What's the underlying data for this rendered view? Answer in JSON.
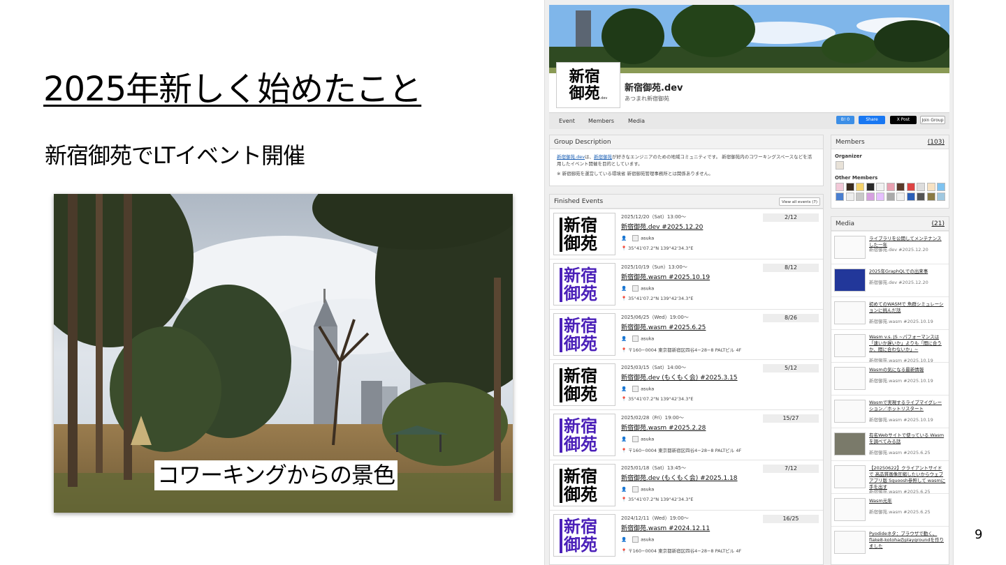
{
  "slide": {
    "title": "2025年新しく始めたこと",
    "subtitle": "新宿御苑でLTイベント開催",
    "photo_caption": "コワーキングからの景色",
    "page_number": "9"
  },
  "group": {
    "logo_text_1": "新宿",
    "logo_text_2": "御苑",
    "logo_suffix": ".dev",
    "name": "新宿御苑.dev",
    "tagline": "あつまれ新宿御苑",
    "tabs": [
      "Event",
      "Members",
      "Media"
    ],
    "share": {
      "hatena": "B! 0",
      "facebook": "Share",
      "x": "X Post",
      "join": "Join Group"
    }
  },
  "description": {
    "header": "Group Description",
    "link1": "新宿御苑.dev",
    "text1": "は、",
    "link2": "新宿御苑",
    "text2": "が好きなエンジニアのための地域コミュニティです。 新宿御苑内のコワーキングスペースなどを活用したイベント開催を目的としています。",
    "note": "※ 新宿御苑を運営している環境省 新宿御苑管理事務所とは関係ありません。"
  },
  "finished": {
    "header": "Finished Events",
    "view_all": "View all events (7)",
    "events": [
      {
        "date": "2025/12/20（Sat）13:00〜",
        "title": "新宿御苑.dev #2025.12.20",
        "host": "asuka",
        "loc": "35°41'07.2\"N 139°42'34.3\"E",
        "count": "2/12",
        "variant": "dev"
      },
      {
        "date": "2025/10/19（Sun）13:00〜",
        "title": "新宿御苑.wasm #2025.10.19",
        "host": "asuka",
        "loc": "35°41'07.2\"N 139°42'34.3\"E",
        "count": "8/12",
        "variant": "wasm"
      },
      {
        "date": "2025/06/25（Wed）19:00〜",
        "title": "新宿御苑.wasm #2025.6.25",
        "host": "asuka",
        "loc": "〒160−0004 東京都新宿区四谷4−28−8 PALTビル 4F",
        "count": "8/26",
        "variant": "wasm"
      },
      {
        "date": "2025/03/15（Sat）14:00〜",
        "title": "新宿御苑.dev (もくもく会) #2025.3.15",
        "host": "asuka",
        "loc": "35°41'07.2\"N 139°42'34.3\"E",
        "count": "5/12",
        "variant": "dev"
      },
      {
        "date": "2025/02/28（Fri）19:00〜",
        "title": "新宿御苑.wasm #2025.2.28",
        "host": "asuka",
        "loc": "〒160−0004 東京都新宿区四谷4−28−8 PALTビル 4F",
        "count": "15/27",
        "variant": "wasm"
      },
      {
        "date": "2025/01/18（Sat）13:45〜",
        "title": "新宿御苑.dev (もくもく会) #2025.1.18",
        "host": "asuka",
        "loc": "35°41'07.2\"N 139°42'34.3\"E",
        "count": "7/12",
        "variant": "dev"
      },
      {
        "date": "2024/12/11（Wed）19:00〜",
        "title": "新宿御苑.wasm #2024.12.11",
        "host": "asuka",
        "loc": "〒160−0004 東京都新宿区四谷4−28−8 PALTビル 4F",
        "count": "16/25",
        "variant": "wasm"
      }
    ]
  },
  "members": {
    "header": "Members",
    "count": "(103)",
    "organizer_label": "Organizer",
    "other_label": "Other Members"
  },
  "media": {
    "header": "Media",
    "count": "(21)",
    "items": [
      {
        "title": "ライブラリを公開してメンテナンスした一年",
        "sub": "新宿御苑.dev #2025.12.20"
      },
      {
        "title": "2025年GraphQLでの出来事",
        "sub": "新宿御苑.dev #2025.12.20"
      },
      {
        "title": "初めてのWASMで 魚群シミュレーションに挑んだ話",
        "sub": "新宿御苑.wasm #2025.10.19"
      },
      {
        "title": "Wasm v.s. JS ~パフォーマンスは「速いか遅いか」よりも「間に合うか、間に合わないか」~",
        "sub": "新宿御苑.wasm #2025.10.19"
      },
      {
        "title": "Wasmの気になる最新情報",
        "sub": "新宿御苑.wasm #2025.10.19"
      },
      {
        "title": "Wasmで実現するライブマイグレーション／ホットリスタート",
        "sub": "新宿御苑.wasm #2025.10.19"
      },
      {
        "title": "有名Webサイトで使っている Wasmを調べてみる話",
        "sub": "新宿御苑.wasm #2025.6.25"
      },
      {
        "title": "【20250622】クライアントサイドで 高品質画像圧縮したいからウェブアプリ版 Squoosh参照して wasmに手を出す",
        "sub": "新宿御苑.wasm #2025.6.25"
      },
      {
        "title": "Wasm元年",
        "sub": "新宿御苑.wasm #2025.6.25"
      },
      {
        "title": "Pyodideネタ：ブラウザで動く、flake8-kotohaのplaygroundを作りました",
        "sub": ""
      }
    ]
  },
  "colors": {
    "wasm_purple": "#4a1fb8",
    "link_blue": "#1a5fb4",
    "sky": "#7fb6ea"
  }
}
